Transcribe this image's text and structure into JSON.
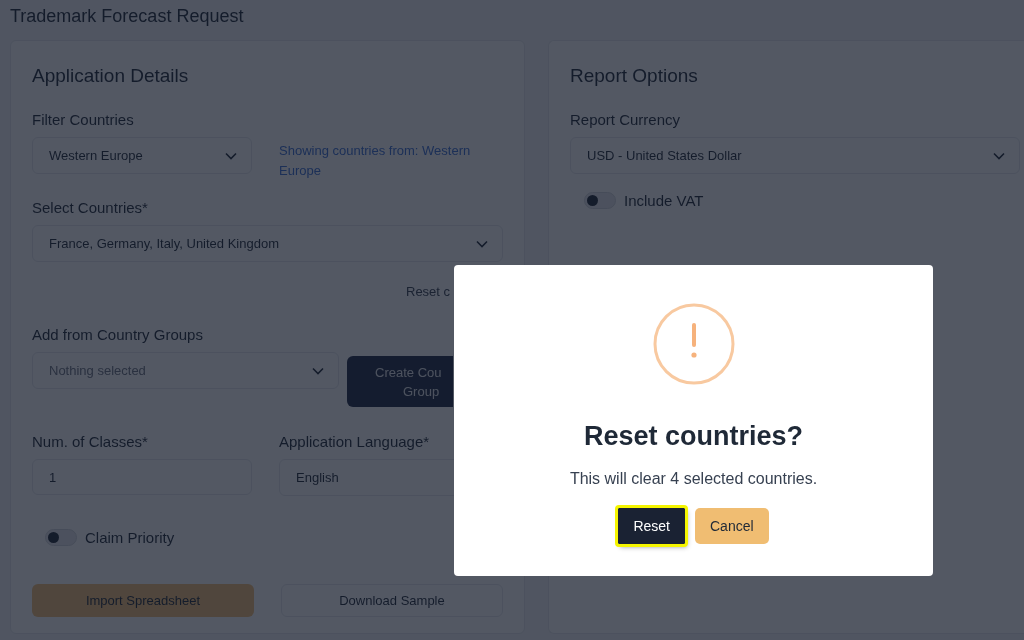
{
  "page_title": "Trademark Forecast Request",
  "application_details": {
    "title": "Application Details",
    "filter_countries": {
      "label": "Filter Countries",
      "value": "Western Europe",
      "info": "Showing countries from: Western Europe"
    },
    "select_countries": {
      "label": "Select Countries*",
      "value": "France, Germany, Italy, United Kingdom"
    },
    "reset_link": "Reset c",
    "country_groups": {
      "label": "Add from Country Groups",
      "placeholder": "Nothing selected",
      "button_lines": [
        "Create Cou",
        "Group"
      ]
    },
    "num_classes": {
      "label": "Num. of Classes*",
      "value": "1"
    },
    "language": {
      "label": "Application Language*",
      "value": "English"
    },
    "claim_priority": {
      "label": "Claim Priority",
      "on": false
    },
    "buttons": [
      {
        "label": "Import Spreadsheet",
        "kind": "primary"
      },
      {
        "label": "Download Sample",
        "kind": "outline"
      }
    ]
  },
  "report_options": {
    "title": "Report Options",
    "currency": {
      "label": "Report Currency",
      "value": "USD - United States Dollar"
    },
    "include_vat": {
      "label": "Include VAT",
      "on": false
    }
  },
  "dialog": {
    "title": "Reset countries?",
    "message": "This will clear 4 selected countries.",
    "buttons": [
      {
        "label": "Reset",
        "kind": "confirm",
        "focused": true
      },
      {
        "label": "Cancel",
        "kind": "cancel",
        "focused": false
      }
    ]
  }
}
